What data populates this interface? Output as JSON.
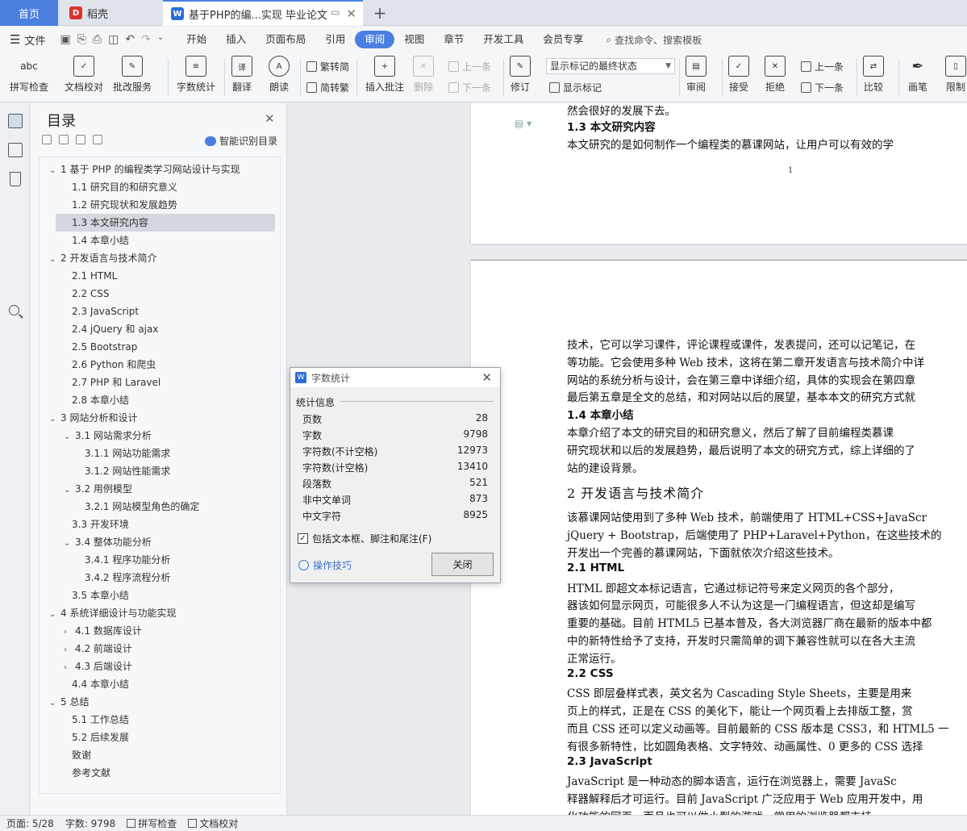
{
  "tabs": {
    "home": "首页",
    "daoke": "稻壳",
    "doc": "基于PHP的编...实现 毕业论文"
  },
  "menu": {
    "file": "文件",
    "tabs": [
      "开始",
      "插入",
      "页面布局",
      "引用",
      "审阅",
      "视图",
      "章节",
      "开发工具",
      "会员专享"
    ],
    "active_index": 4,
    "search": "查找命令、搜索模板"
  },
  "ribbon": {
    "spell_check": "拼写检查",
    "doc_check": "文档校对",
    "batch_service": "批改服务",
    "word_count": "字数统计",
    "translate": "翻译",
    "read_aloud": "朗读",
    "to_traditional": "繁转简",
    "to_simplified": "简转繁",
    "insert_comment": "插入批注",
    "delete": "删除",
    "prev": "上一条",
    "next": "下一条",
    "revise": "修订",
    "markup_state": "显示标记的最终状态",
    "show_markup": "显示标记",
    "review": "审阅",
    "accept": "接受",
    "reject": "拒绝",
    "prev2": "上一条",
    "next2": "下一条",
    "compare": "比较",
    "pen": "画笔",
    "restrict": "限制"
  },
  "toc": {
    "title": "目录",
    "smart": "智能识别目录",
    "items": [
      {
        "text": "1  基于 PHP 的编程类学习网站设计与实现",
        "level": 1,
        "arrow": "v"
      },
      {
        "text": "1.1  研究目的和研究意义",
        "level": 2,
        "arrow": ""
      },
      {
        "text": "1.2  研究现状和发展趋势",
        "level": 2,
        "arrow": ""
      },
      {
        "text": "1.3  本文研究内容",
        "level": 2,
        "arrow": "",
        "selected": true
      },
      {
        "text": "1.4  本章小结",
        "level": 2,
        "arrow": ""
      },
      {
        "text": "2  开发语言与技术简介",
        "level": 1,
        "arrow": "v"
      },
      {
        "text": "2.1 HTML",
        "level": 2,
        "arrow": ""
      },
      {
        "text": "2.2 CSS",
        "level": 2,
        "arrow": ""
      },
      {
        "text": "2.3 JavaScript",
        "level": 2,
        "arrow": ""
      },
      {
        "text": "2.4 jQuery 和 ajax",
        "level": 2,
        "arrow": ""
      },
      {
        "text": "2.5 Bootstrap",
        "level": 2,
        "arrow": ""
      },
      {
        "text": "2.6 Python 和爬虫",
        "level": 2,
        "arrow": ""
      },
      {
        "text": "2.7 PHP 和 Laravel",
        "level": 2,
        "arrow": ""
      },
      {
        "text": "2.8  本章小结",
        "level": 2,
        "arrow": ""
      },
      {
        "text": "3  网站分析和设计",
        "level": 1,
        "arrow": "v"
      },
      {
        "text": "3.1  网站需求分析",
        "level": 2,
        "arrow": "v"
      },
      {
        "text": "3.1.1  网站功能需求",
        "level": 3,
        "arrow": ""
      },
      {
        "text": "3.1.2  网站性能需求",
        "level": 3,
        "arrow": ""
      },
      {
        "text": "3.2  用例模型",
        "level": 2,
        "arrow": "v"
      },
      {
        "text": "3.2.1 网站模型角色的确定",
        "level": 3,
        "arrow": ""
      },
      {
        "text": "3.3  开发环境",
        "level": 2,
        "arrow": ""
      },
      {
        "text": "3.4  整体功能分析",
        "level": 2,
        "arrow": "v"
      },
      {
        "text": "3.4.1  程序功能分析",
        "level": 3,
        "arrow": ""
      },
      {
        "text": "3.4.2  程序流程分析",
        "level": 3,
        "arrow": ""
      },
      {
        "text": "3.5  本章小结",
        "level": 2,
        "arrow": ""
      },
      {
        "text": "4  系统详细设计与功能实现",
        "level": 1,
        "arrow": "v"
      },
      {
        "text": "4.1  数据库设计",
        "level": 2,
        "arrow": ">"
      },
      {
        "text": "4.2  前端设计",
        "level": 2,
        "arrow": ">"
      },
      {
        "text": "4.3  后端设计",
        "level": 2,
        "arrow": ">"
      },
      {
        "text": "4.4  本章小结",
        "level": 2,
        "arrow": ""
      },
      {
        "text": "5  总结",
        "level": 1,
        "arrow": "v"
      },
      {
        "text": "5.1  工作总结",
        "level": 2,
        "arrow": ""
      },
      {
        "text": "5.2  后续发展",
        "level": 2,
        "arrow": ""
      },
      {
        "text": "致谢",
        "level": 2,
        "arrow": ""
      },
      {
        "text": "参考文献",
        "level": 2,
        "arrow": ""
      }
    ]
  },
  "doc": {
    "page1_lines": [
      "然会很好的发展下去。",
      "1.3  本文研究内容",
      "    本文研究的是如何制作一个编程类的慕课网站，让用户可以有效的学"
    ],
    "page_number": "1",
    "page2_lines": [
      "技术，它可以学习课件，评论课程或课件，发表提问，还可以记笔记，在",
      "等功能。它会使用多种 Web 技术，这将在第二章开发语言与技术简介中详",
      "网站的系统分析与设计，会在第三章中详细介绍，具体的实现会在第四章",
      "最后第五章是全文的总结，和对网站以后的展望，基本本文的研究方式就",
      "1.4  本章小结",
      "    本章介绍了本文的研究目的和研究意义，然后了解了目前编程类慕课",
      "研究现状和以后的发展趋势，最后说明了本文的研究方式，综上详细的了",
      "站的建设背景。",
      "2  开发语言与技术简介",
      "    该慕课网站使用到了多种 Web 技术，前端使用了 HTML+CSS+JavaScr",
      "jQuery + Bootstrap，后端使用了 PHP+Laravel+Python，在这些技术的",
      "开发出一个完善的慕课网站，下面就依次介绍这些技术。",
      "2.1  HTML",
      "    HTML 即超文本标记语言，它通过标记符号来定义网页的各个部分，",
      "器该如何显示网页，可能很多人不认为这是一门编程语言，但这却是编写",
      "重要的基础。目前 HTML5 已基本普及，各大浏览器厂商在最新的版本中都",
      "中的新特性给予了支持，开发时只需简单的调下兼容性就可以在各大主流",
      "正常运行。",
      "2.2  CSS",
      "    CSS 即层叠样式表，英文名为 Cascading Style Sheets，主要是用来",
      "页上的样式，正是在 CSS 的美化下，能让一个网页看上去排版工整，赏",
      "而且 CSS 还可以定义动画等。目前最新的 CSS 版本是 CSS3，和 HTML5 一",
      "有很多新特性，比如圆角表格、文字特效、动画属性、0 更多的 CSS 选择",
      "2.3  JavaScript",
      "    JavaScript 是一种动态的脚本语言，运行在浏览器上，需要 JavaSc",
      "释器解释后才可运行。目前 JavaScript 广泛应用于 Web 应用开发中，用",
      "化功能的网页，而且也可以做小型的游戏。常用的浏览器都支持"
    ]
  },
  "dialog": {
    "title": "字数统计",
    "section": "统计信息",
    "rows": [
      {
        "label": "页数",
        "value": "28"
      },
      {
        "label": "字数",
        "value": "9798"
      },
      {
        "label": "字符数(不计空格)",
        "value": "12973"
      },
      {
        "label": "字符数(计空格)",
        "value": "13410"
      },
      {
        "label": "段落数",
        "value": "521"
      },
      {
        "label": "非中文单词",
        "value": "873"
      },
      {
        "label": "中文字符",
        "value": "8925"
      }
    ],
    "include_check": "包括文本框、脚注和尾注(F)",
    "tips": "操作技巧",
    "close": "关闭"
  },
  "status": {
    "page": "页面: 5/28",
    "words": "字数: 9798",
    "spell": "拼写检查",
    "proof": "文档校对"
  }
}
